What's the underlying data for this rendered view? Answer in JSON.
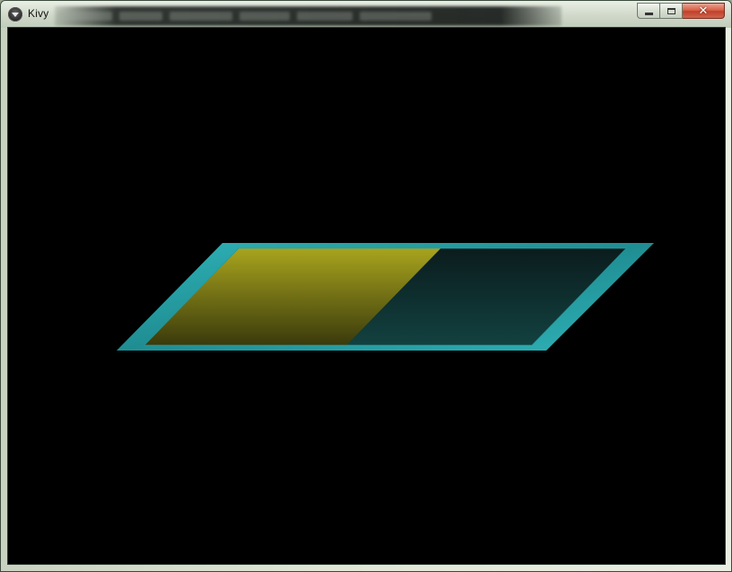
{
  "window": {
    "title": "Kivy",
    "app_icon": "kivy-logo-icon",
    "buttons": {
      "minimize_icon": "minimize-icon",
      "maximize_icon": "maximize-icon",
      "close_icon": "close-icon"
    }
  },
  "progress_bar": {
    "value": 0.4,
    "colors": {
      "frame": "#1f8e93",
      "frame_highlight": "#2fb3b8",
      "fill_top": "#a8a41e",
      "fill_bottom": "#3a3a0c",
      "track_top": "#0b1c1d",
      "track_bottom": "#124140"
    }
  }
}
